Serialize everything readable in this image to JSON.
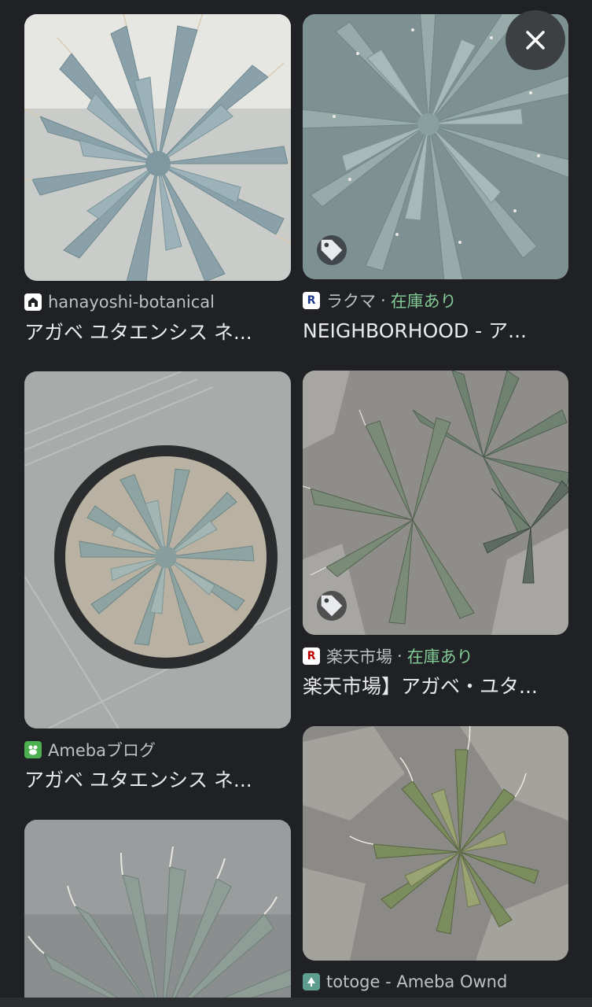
{
  "close_label": "×",
  "results": {
    "left": [
      {
        "source": "hanayoshi-botanical",
        "title": "アガベ ユタエンシス ネ...",
        "favicon_color": "#ffffff",
        "favicon_icon": "house-icon",
        "image_tone": "agave-closeup-bluegray"
      },
      {
        "source": "Amebaブログ",
        "title": "アガベ ユタエンシス ネ...",
        "favicon_color": "#4caf50",
        "favicon_icon": "ameba-frog-icon",
        "image_tone": "agave-in-pot-topdown"
      },
      {
        "image_tone": "agave-spiky-gray"
      }
    ],
    "right": [
      {
        "source": "ラクマ",
        "stock": "在庫あり",
        "separator": "·",
        "title": "NEIGHBORHOOD - ア...",
        "favicon_color": "#1e3a8a",
        "favicon_letter": "R",
        "image_tone": "agave-rosette-bluegray",
        "has_tag": true
      },
      {
        "source": "楽天市場",
        "stock": "在庫あり",
        "separator": "·",
        "title": "楽天市場】アガベ・ユタ...",
        "favicon_color": "#bf0000",
        "favicon_letter": "R",
        "image_tone": "agave-cluster-rocks",
        "has_tag": true
      },
      {
        "source": "totoge - Ameba Ownd",
        "favicon_color": "#5f9e8f",
        "favicon_icon": "tree-icon",
        "image_tone": "agave-on-rock"
      }
    ]
  }
}
